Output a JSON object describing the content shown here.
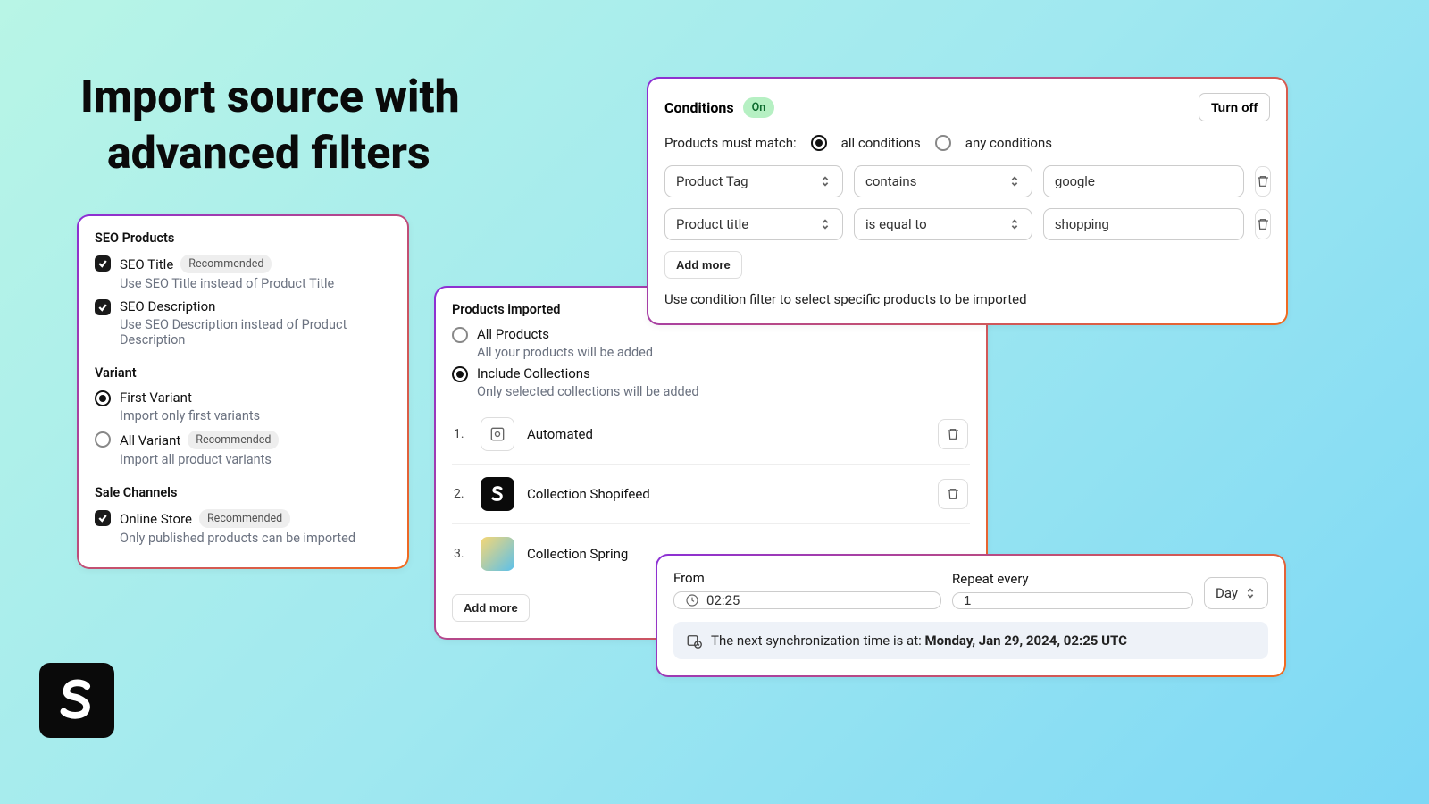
{
  "headline": {
    "line1": "Import source with",
    "line2": "advanced filters"
  },
  "seo_panel": {
    "title": "SEO Products",
    "seo_title": {
      "label": "SEO Title",
      "badge": "Recommended",
      "desc": "Use SEO Title instead of Product Title"
    },
    "seo_desc": {
      "label": "SEO Description",
      "desc": "Use SEO Description instead of Product Description"
    },
    "variant_title": "Variant",
    "first_variant": {
      "label": "First Variant",
      "desc": "Import only first variants"
    },
    "all_variant": {
      "label": "All Variant",
      "badge": "Recommended",
      "desc": "Import all product variants"
    },
    "channels_title": "Sale Channels",
    "online_store": {
      "label": "Online Store",
      "badge": "Recommended",
      "desc": "Only published products can be imported"
    }
  },
  "imported_panel": {
    "title": "Products imported",
    "all": {
      "label": "All Products",
      "desc": "All your products will be added"
    },
    "include": {
      "label": "Include Collections",
      "desc": "Only selected collections will be added"
    },
    "collections": [
      {
        "idx": "1.",
        "name": "Automated"
      },
      {
        "idx": "2.",
        "name": "Collection Shopifeed"
      },
      {
        "idx": "3.",
        "name": "Collection Spring"
      }
    ],
    "add_more": "Add more"
  },
  "conditions_panel": {
    "title": "Conditions",
    "on_badge": "On",
    "turn_off": "Turn off",
    "match_label": "Products must match:",
    "match_all": "all conditions",
    "match_any": "any conditions",
    "rows": [
      {
        "field": "Product Tag",
        "op": "contains",
        "val": "google"
      },
      {
        "field": "Product title",
        "op": "is equal to",
        "val": "shopping"
      }
    ],
    "add_more": "Add more",
    "desc": "Use condition filter to select specific products to be imported"
  },
  "sync_panel": {
    "from_label": "From",
    "from_value": "02:25",
    "repeat_label": "Repeat every",
    "repeat_value": "1",
    "unit": "Day",
    "info_prefix": "The next synchronization time is at: ",
    "info_time": "Monday, Jan 29, 2024, 02:25 UTC"
  }
}
